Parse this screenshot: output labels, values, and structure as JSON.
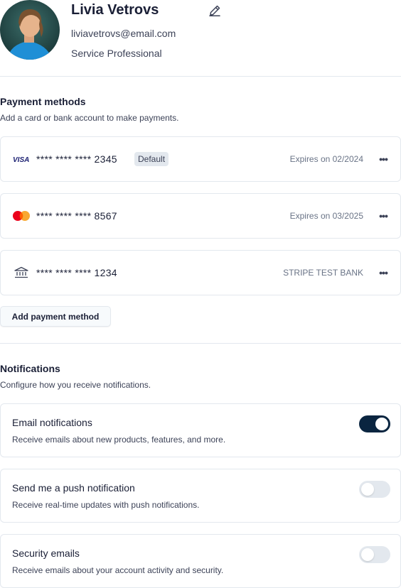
{
  "profile": {
    "name": "Livia Vetrovs",
    "email": "liviavetrovs@email.com",
    "role": "Service Professional"
  },
  "payment": {
    "title": "Payment methods",
    "description": "Add a card or bank account to make payments.",
    "methods": [
      {
        "icon": "visa-icon",
        "number": "**** **** **** 2345",
        "badge": "Default",
        "meta": "Expires on 02/2024"
      },
      {
        "icon": "mastercard-icon",
        "number": "**** **** **** 8567",
        "meta": "Expires on 03/2025"
      },
      {
        "icon": "bank-icon",
        "number": "**** **** **** 1234",
        "meta": "STRIPE TEST BANK"
      }
    ],
    "add_label": "Add payment method"
  },
  "notifications": {
    "title": "Notifications",
    "description": "Configure how you receive notifications.",
    "items": [
      {
        "title": "Email notifications",
        "description": "Receive emails about new products, features, and more.",
        "enabled": true
      },
      {
        "title": "Send me a push notification",
        "description": "Receive real-time updates with push notifications.",
        "enabled": false
      },
      {
        "title": "Security emails",
        "description": "Receive emails about your account activity and security.",
        "enabled": false
      }
    ]
  },
  "colors": {
    "text": "#1a1f36",
    "muted": "#697386",
    "border": "#e3e8ee",
    "toggle_on": "#0a2540",
    "visa": "#1a1f71",
    "mastercard_red": "#eb001b",
    "mastercard_orange": "#f79e1b"
  }
}
